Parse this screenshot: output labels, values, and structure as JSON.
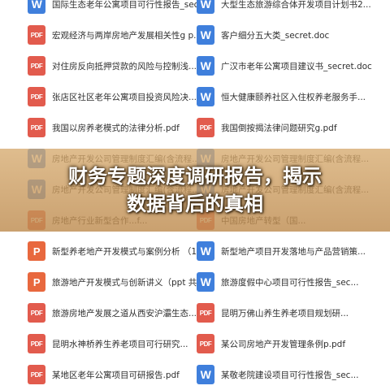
{
  "banner": {
    "line1": "财务专题深度调研报告，揭示",
    "line2": "数据背后的真相"
  },
  "files": {
    "left": [
      {
        "type": "W",
        "name": "国际生态老年公寓项目可行性报告_sec..."
      },
      {
        "type": "PDF",
        "name": "宏观经济与两岸房地产发展相关性g p..."
      },
      {
        "type": "PDF",
        "name": "对住房反向抵押贷款的风险与控制浅..."
      },
      {
        "type": "PDF",
        "name": "张店区社区老年公寓项目投资风险决..."
      },
      {
        "type": "PDF",
        "name": "我国以房养老模式的法律分析.pdf"
      },
      {
        "type": "W",
        "name": "房地产开发公司管理制度汇编(含流程..."
      },
      {
        "type": "W",
        "name": "房地产开发公司管理制度汇编(含流程..."
      },
      {
        "type": "PDF",
        "name": "房地产行业新型合作...f..."
      },
      {
        "type": "P",
        "name": "新型养老地产开发模式与案例分析 （1..."
      },
      {
        "type": "P",
        "name": "旅游地产开发模式与创新讲义（ppt 共..."
      },
      {
        "type": "PDF",
        "name": "旅游房地产发展之道从西安沪灞生态..."
      },
      {
        "type": "PDF",
        "name": "昆明水神桥养生养老项目可行研究..."
      },
      {
        "type": "PDF",
        "name": "某地区老年公寓项目可研报告.pdf"
      }
    ],
    "right": [
      {
        "type": "W",
        "name": "大型生态旅游综合体开发项目计划书2..."
      },
      {
        "type": "W",
        "name": "客户细分五大类_secret.doc"
      },
      {
        "type": "W",
        "name": "广汉市老年公寓项目建议书_secret.doc"
      },
      {
        "type": "W",
        "name": "恒大健康颐养社区入住权养老服务手..."
      },
      {
        "type": "PDF",
        "name": "我国倒按揭法律问题研究g.pdf"
      },
      {
        "type": "W",
        "name": "房地产开发公司管理制度汇编(含流程..."
      },
      {
        "type": "W",
        "name": "房地产开发公司管理制度汇编(含流程..."
      },
      {
        "type": "PDF",
        "name": "中国房地产转型（国..."
      },
      {
        "type": "W",
        "name": "新型地产项目开发落地与产品营销策..."
      },
      {
        "type": "W",
        "name": "旅游度假中心项目可行性报告_sec..."
      },
      {
        "type": "PDF",
        "name": "昆明万佛山养生养老项目规划研..."
      },
      {
        "type": "PDF",
        "name": "某公司房地产开发管理条例p.pdf"
      },
      {
        "type": "W",
        "name": "某敬老院建设项目可行性报告_sec..."
      }
    ]
  },
  "colors": {
    "pdf": "#e25b4d",
    "word": "#3f7fdc",
    "ppt": "#e8683e",
    "banner": "#d4a66a"
  }
}
